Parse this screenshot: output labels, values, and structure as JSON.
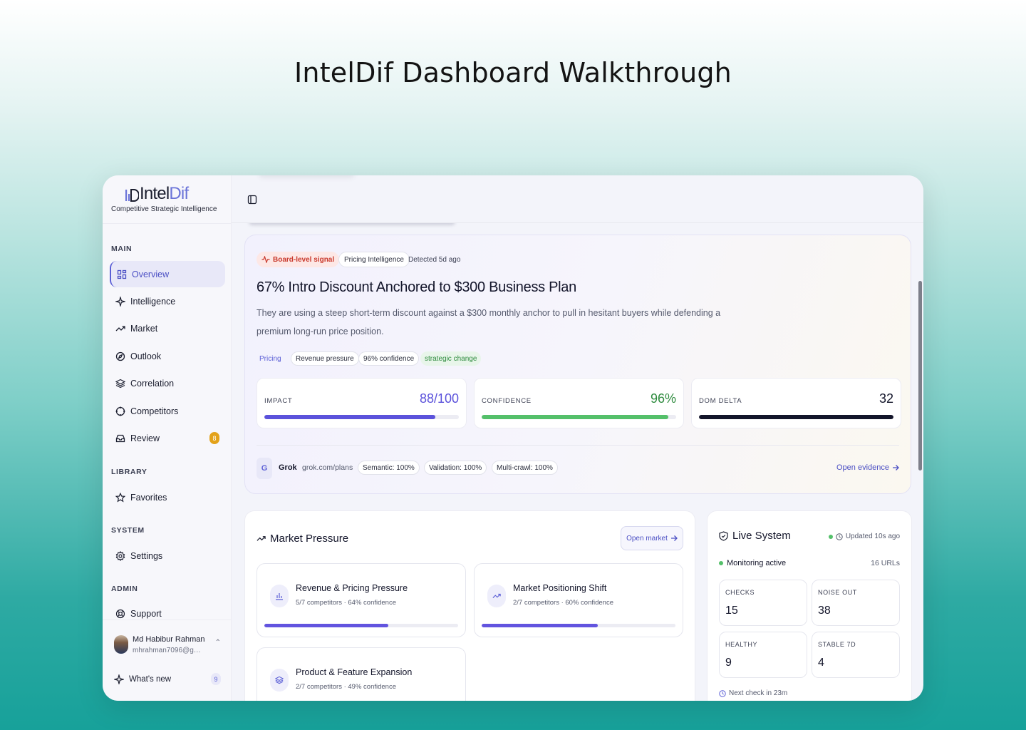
{
  "page_title": "IntelDif Dashboard Walkthrough",
  "brand": {
    "name_a": "Intel",
    "name_b": "Dif",
    "tagline": "Competitive Strategic Intelligence",
    "accent": "#6b74d8"
  },
  "sidebar": {
    "sections": {
      "main": "MAIN",
      "library": "LIBRARY",
      "system": "SYSTEM",
      "admin": "ADMIN"
    },
    "items": [
      {
        "label": "Overview",
        "icon": "grid-icon",
        "active": true
      },
      {
        "label": "Intelligence",
        "icon": "sparkles-icon"
      },
      {
        "label": "Market",
        "icon": "trending-up-icon"
      },
      {
        "label": "Outlook",
        "icon": "compass-icon"
      },
      {
        "label": "Correlation",
        "icon": "layers-icon"
      },
      {
        "label": "Competitors",
        "icon": "crosshair-icon"
      },
      {
        "label": "Review",
        "icon": "inbox-icon",
        "badge": "8"
      },
      {
        "label": "Favorites",
        "icon": "star-icon"
      },
      {
        "label": "Settings",
        "icon": "gear-icon"
      },
      {
        "label": "Support",
        "icon": "lifebuoy-icon"
      }
    ],
    "user": {
      "name": "Md Habibur Rahman",
      "email": "mhrahman7096@gmail..."
    },
    "whats_new": {
      "label": "What's new",
      "count": "9"
    }
  },
  "hero": {
    "chips": {
      "signal": "Board-level signal",
      "category": "Pricing Intelligence",
      "detected": "Detected 5d ago"
    },
    "title": "67% Intro Discount Anchored to $300 Business Plan",
    "description": "They are using a steep short-term discount against a $300 monthly anchor to pull in hesitant buyers while defending a premium long-run price position.",
    "tags": {
      "pricing": "Pricing",
      "revenue": "Revenue pressure",
      "confidence": "96% confidence",
      "change": "strategic change"
    },
    "metrics": [
      {
        "label": "IMPACT",
        "value": "88/100",
        "fraction": 0.88,
        "color": "#5b52db"
      },
      {
        "label": "CONFIDENCE",
        "value": "96%",
        "fraction": 0.96,
        "color": "#54c06a"
      },
      {
        "label": "DOM DELTA",
        "value": "32",
        "fraction": 1.0,
        "color": "#13152a"
      }
    ],
    "source": {
      "initial": "G",
      "name": "Grok",
      "url": "grok.com/plans"
    },
    "evidence": {
      "semantic": "Semantic: 100%",
      "validation": "Validation: 100%",
      "multicrawl": "Multi-crawl: 100%"
    },
    "open_evidence": "Open evidence"
  },
  "market_pressure": {
    "title": "Market Pressure",
    "button": "Open market",
    "cards": [
      {
        "title": "Revenue & Pricing Pressure",
        "sub": "5/7 competitors · 64% confidence",
        "fraction": 0.64,
        "icon": "bar-chart-icon"
      },
      {
        "title": "Market Positioning Shift",
        "sub": "2/7 competitors · 60% confidence",
        "fraction": 0.6,
        "icon": "trending-up-icon"
      },
      {
        "title": "Product & Feature Expansion",
        "sub": "2/7 competitors · 49% confidence",
        "fraction": 0.49,
        "icon": "layers-icon"
      }
    ]
  },
  "live_system": {
    "title": "Live System",
    "updated": "Updated 10s ago",
    "monitoring": "Monitoring active",
    "urls": "16 URLs",
    "stats": [
      {
        "label": "CHECKS",
        "value": "15"
      },
      {
        "label": "NOISE OUT",
        "value": "38"
      },
      {
        "label": "HEALTHY",
        "value": "9"
      },
      {
        "label": "STABLE 7D",
        "value": "4"
      }
    ],
    "next_check": "Next check in 23m"
  }
}
